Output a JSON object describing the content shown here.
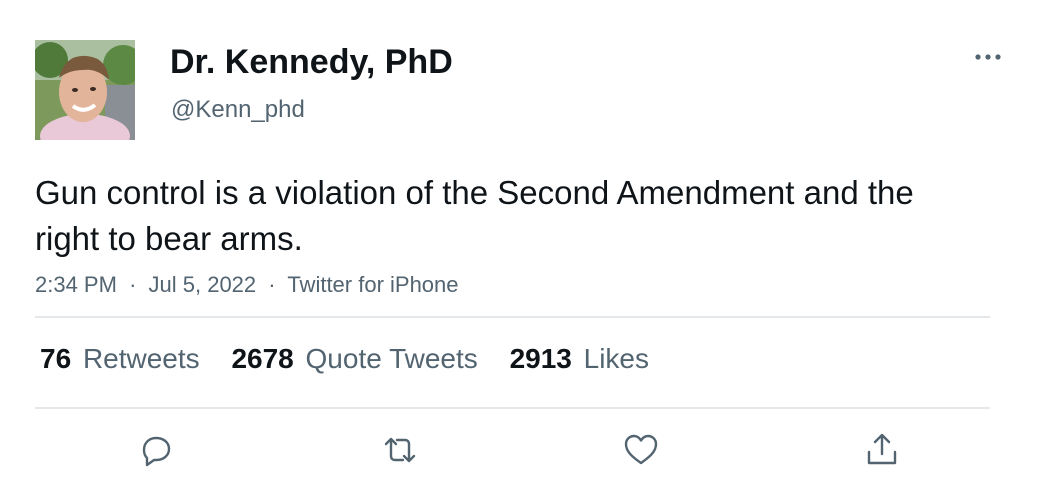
{
  "tweet": {
    "author": {
      "display_name": "Dr. Kennedy, PhD",
      "handle": "@Kenn_phd"
    },
    "text": "Gun control is a violation of the Second Amendment and the right to bear arms.",
    "time": "2:34 PM",
    "date": "Jul 5, 2022",
    "source": "Twitter for iPhone",
    "separator": "·",
    "stats": {
      "retweets_count": "76",
      "retweets_label": "Retweets",
      "quotes_count": "2678",
      "quotes_label": "Quote Tweets",
      "likes_count": "2913",
      "likes_label": "Likes"
    }
  },
  "icons": {
    "more": "more-horizontal-icon",
    "reply": "reply-icon",
    "retweet": "retweet-icon",
    "like": "heart-icon",
    "share": "share-icon"
  },
  "colors": {
    "text_primary": "#0f1419",
    "text_secondary": "#536471",
    "divider": "#e4e8eb"
  }
}
